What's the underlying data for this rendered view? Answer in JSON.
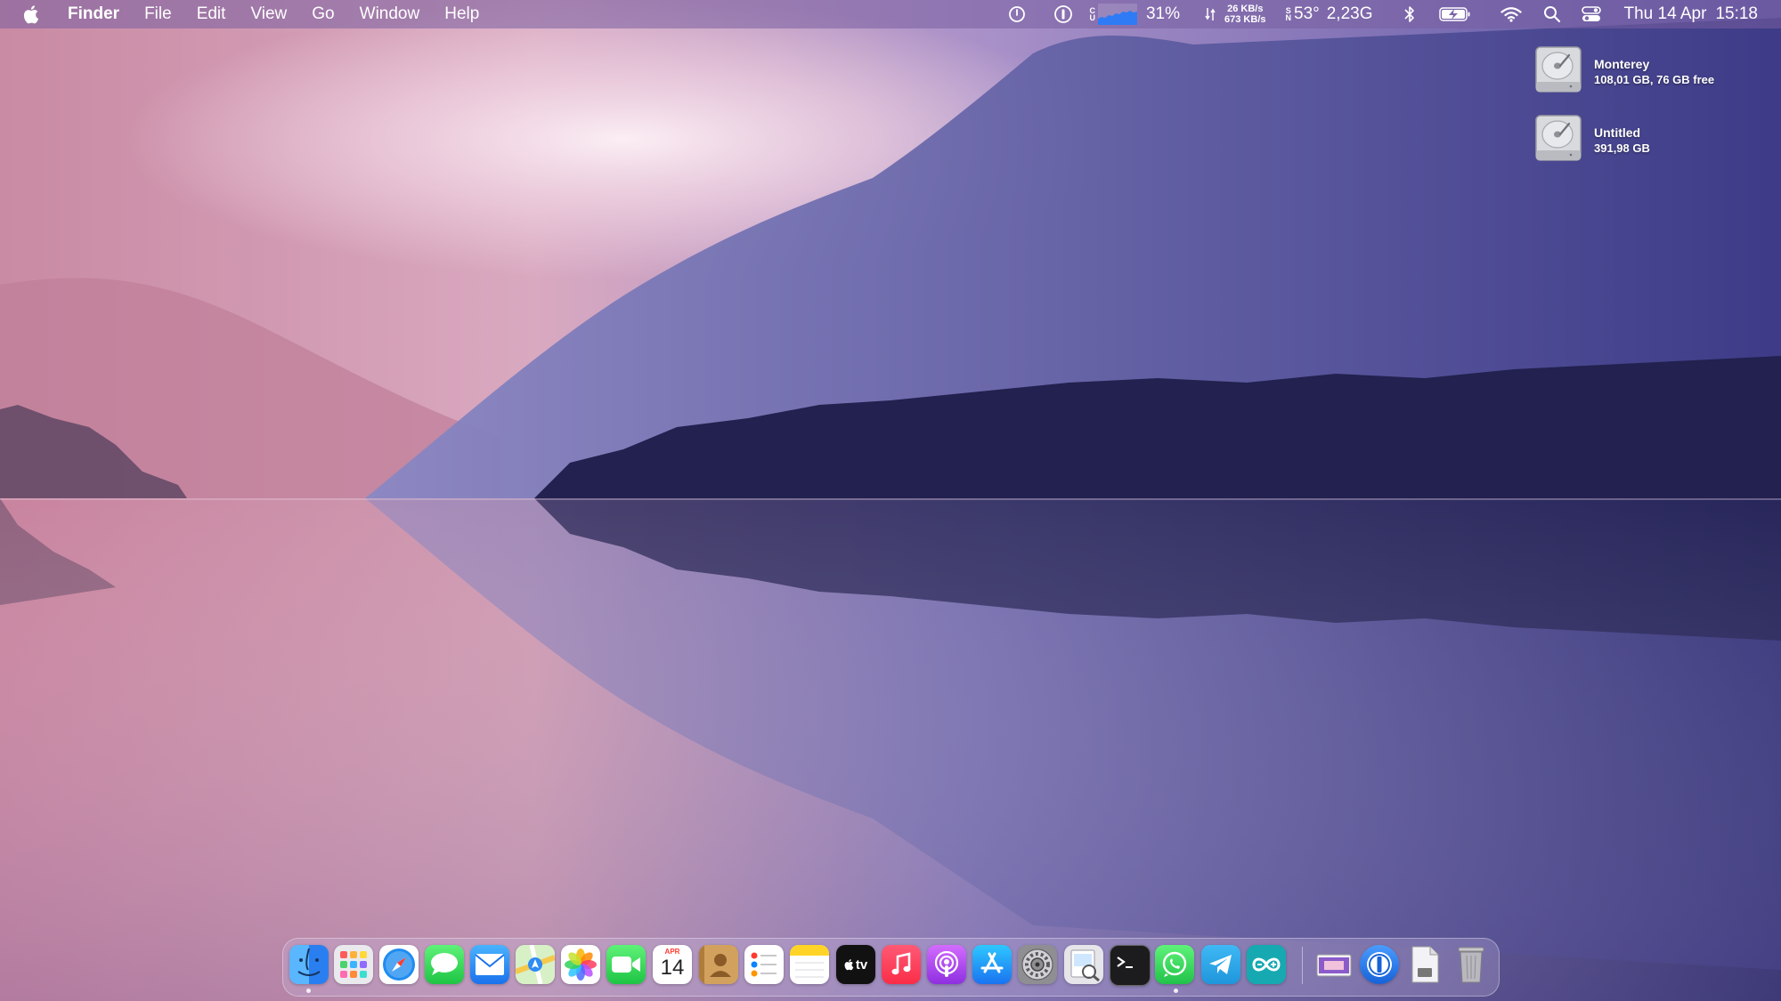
{
  "menubar": {
    "app_name": "Finder",
    "menus": [
      "File",
      "Edit",
      "View",
      "Go",
      "Window",
      "Help"
    ],
    "cpu_label_top": "C",
    "cpu_label_bottom": "U",
    "cpu_percent": "31%",
    "net_up": "26 KB/s",
    "net_down": "673 KB/s",
    "sensor_label_top": "S",
    "sensor_label_bottom": "N",
    "temperature": "53°",
    "frequency": "2,23G",
    "date": "Thu 14 Apr",
    "time": "15:18"
  },
  "desktop": {
    "drives": [
      {
        "name": "Monterey",
        "info": "108,01 GB, 76 GB free"
      },
      {
        "name": "Untitled",
        "info": "391,98 GB"
      }
    ]
  },
  "dock": {
    "calendar_month": "APR",
    "calendar_day": "14",
    "tv_label": "tv"
  }
}
